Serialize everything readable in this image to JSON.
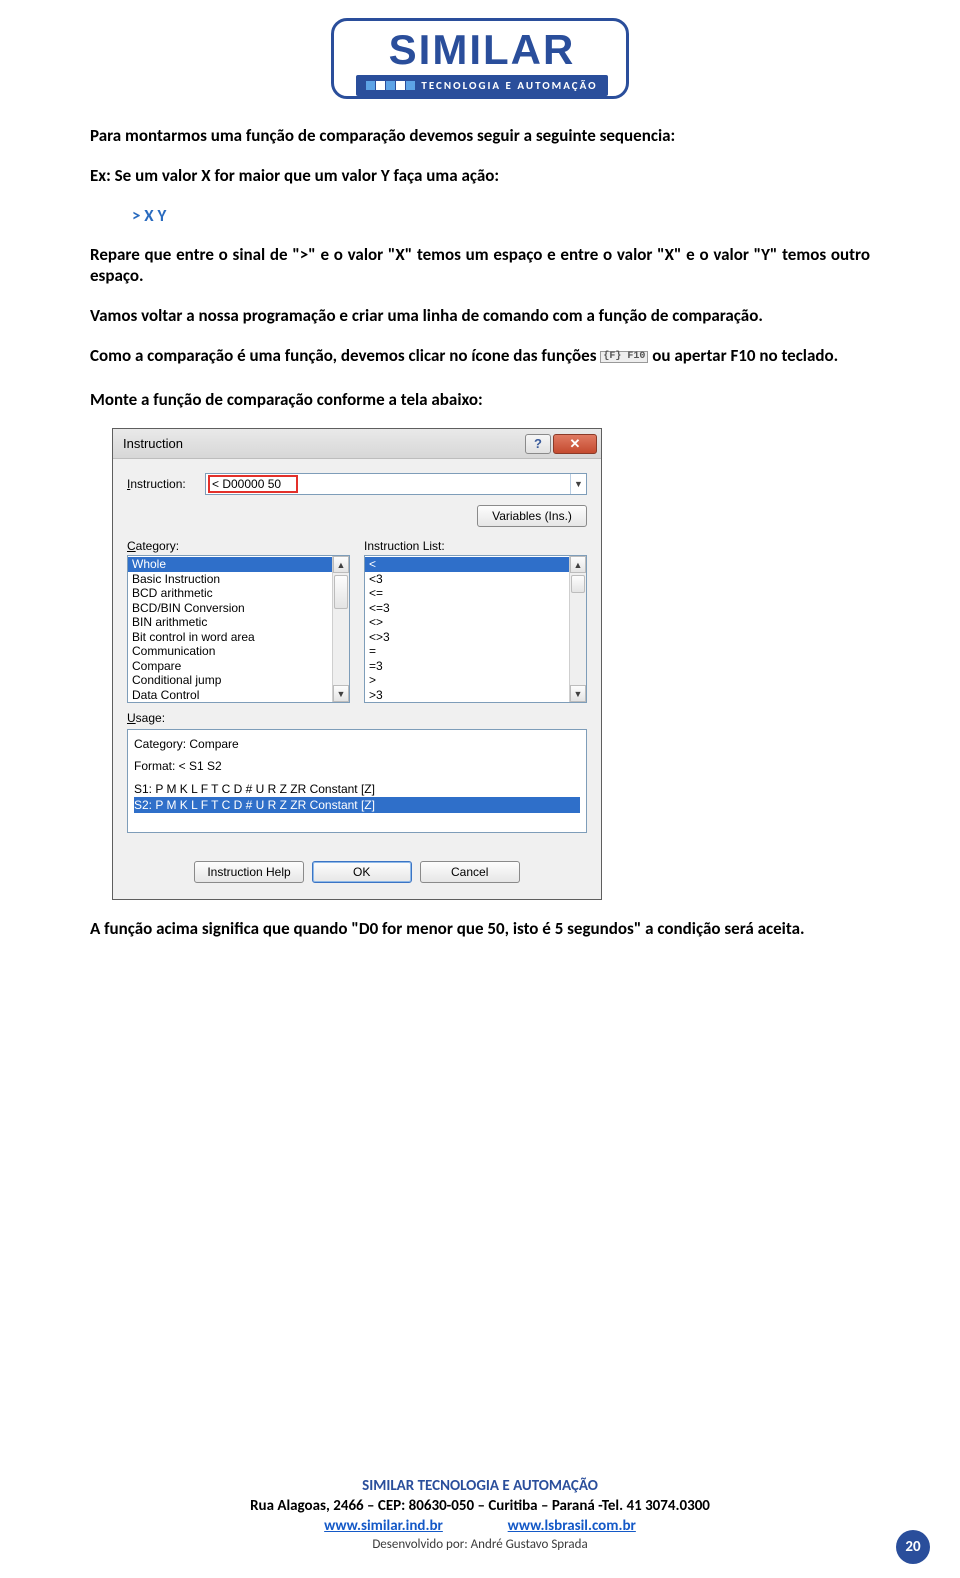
{
  "logo": {
    "word": "SIMILAR",
    "sub": "TECNOLOGIA  E  AUTOMAÇÃO"
  },
  "body": {
    "p1": "Para montarmos uma função de comparação devemos seguir a seguinte sequencia:",
    "p2": "Ex: Se um valor X for maior que um valor Y faça uma ação:",
    "expr": "> X Y",
    "p3": "Repare que entre o sinal de \">\" e o valor \"X\" temos um espaço e entre o valor \"X\" e o valor \"Y\" temos outro espaço.",
    "p4": "Vamos voltar a nossa programação e criar uma linha de comando com a função de comparação.",
    "p5a": "Como a comparação é uma função, devemos clicar no ícone das funções ",
    "p5_icon": "{F}\nF10",
    "p5b": " ou apertar F10 no teclado.",
    "p6": "Monte a função de comparação conforme a tela abaixo:",
    "p7": "A função acima significa que quando \"D0 for menor que 50, isto é 5 segundos\" a condição será aceita."
  },
  "dialog": {
    "title": "Instruction",
    "help_btn": "?",
    "close_btn": "✕",
    "instruction_label": "Instruction:",
    "instruction_value": "< D00000 50",
    "variables_btn": "Variables (Ins.)",
    "category_label": "Category:",
    "instruction_list_label": "Instruction List:",
    "categories": [
      "Whole",
      "Basic Instruction",
      "BCD arithmetic",
      "BCD/BIN Conversion",
      "BIN arithmetic",
      "Bit control in word area",
      "Communication",
      "Compare",
      "Conditional jump",
      "Data Control"
    ],
    "category_selected": 0,
    "instructions": [
      "<",
      "<3",
      "<=",
      "<=3",
      "<>",
      "<>3",
      "=",
      "=3",
      ">",
      ">3"
    ],
    "instruction_selected": 0,
    "usage_label": "Usage:",
    "usage": {
      "l1": "Category: Compare",
      "l2": "Format: < S1 S2",
      "l3": "S1:  P M K L F T C D # U R Z ZR Constant [Z]",
      "l4": "S2:  P M K L F T C D # U R Z ZR Constant [Z]"
    },
    "btn_help": "Instruction Help",
    "btn_ok": "OK",
    "btn_cancel": "Cancel"
  },
  "footer": {
    "company": "SIMILAR TECNOLOGIA E AUTOMAÇÃO",
    "addr": "Rua Alagoas, 2466 – CEP: 80630-050 – Curitiba – Paraná -Tel. 41 3074.0300",
    "link1": "www.similar.ind.br",
    "link2": "www.lsbrasil.com.br",
    "dev": "Desenvolvido por: André Gustavo Sprada",
    "page": "20"
  }
}
